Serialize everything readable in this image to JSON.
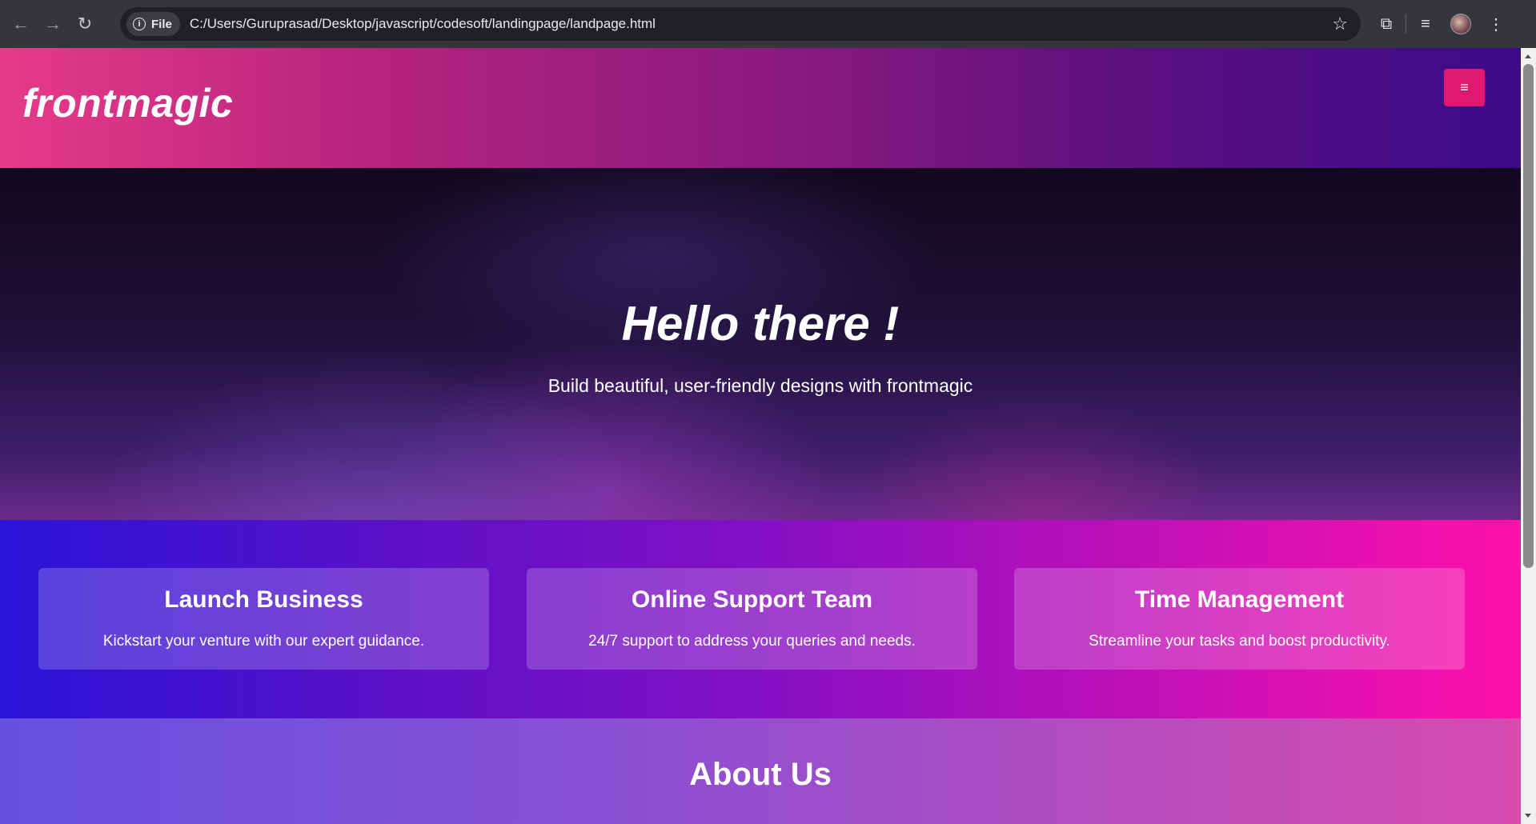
{
  "browser": {
    "back_icon": "←",
    "forward_icon": "→",
    "reload_icon": "↻",
    "scheme_label": "File",
    "info_icon": "i",
    "url": "C:/Users/Guruprasad/Desktop/javascript/codesoft/landingpage/landpage.html",
    "star_icon": "☆",
    "extensions_icon": "⧉",
    "media_icon": "≡",
    "menu_icon": "⋮"
  },
  "site": {
    "logo": "frontmagic",
    "menu_button": "≡"
  },
  "hero": {
    "title": "Hello there !",
    "subtitle": "Build beautiful, user-friendly designs with frontmagic"
  },
  "features": [
    {
      "title": "Launch Business",
      "text": "Kickstart your venture with our expert guidance."
    },
    {
      "title": "Online Support Team",
      "text": "24/7 support to address your queries and needs."
    },
    {
      "title": "Time Management",
      "text": "Streamline your tasks and boost productivity."
    }
  ],
  "about": {
    "title": "About Us"
  },
  "colors": {
    "menu_button": "#e0186f",
    "header_left": "#e73a8a",
    "header_right": "#3c0a8a",
    "features_left": "#2a14d8",
    "features_right": "#ff10aa"
  }
}
